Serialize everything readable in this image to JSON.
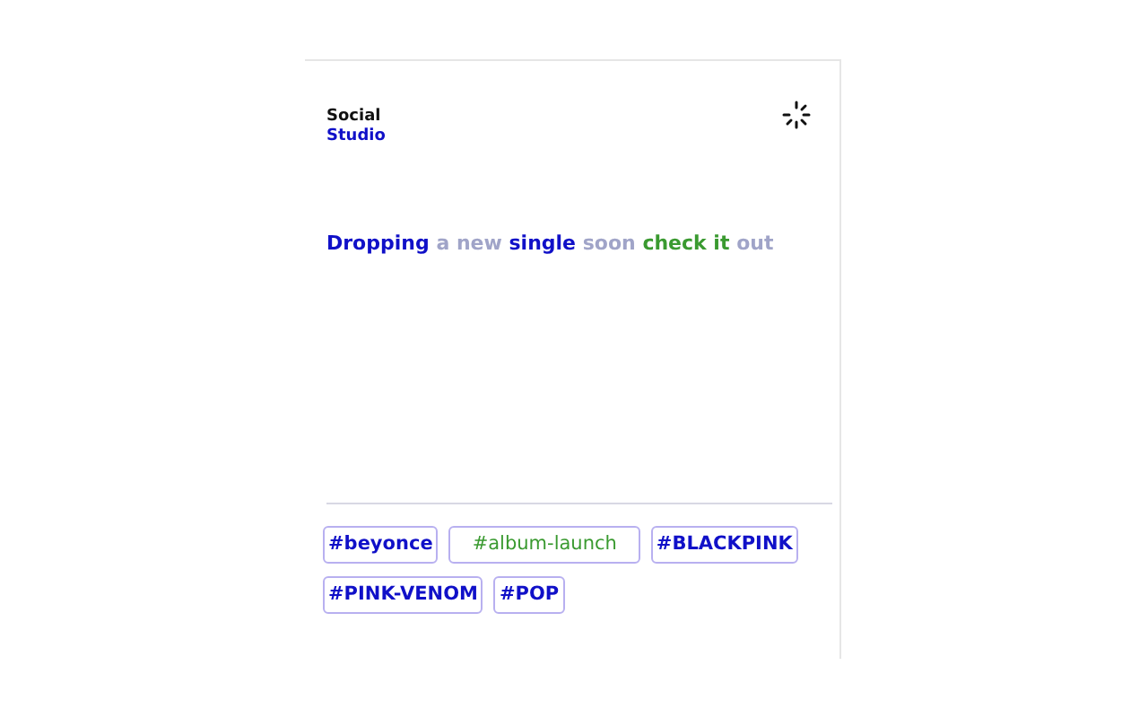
{
  "brand": {
    "line_1": "Social",
    "line_2": "Studio"
  },
  "post": {
    "segments": [
      {
        "text": "Dropping",
        "color": "#1010c8"
      },
      {
        "text": "a new",
        "color": "#a0a4c8"
      },
      {
        "text": "single",
        "color": "#1010c8"
      },
      {
        "text": "soon",
        "color": "#a0a4c8"
      },
      {
        "text": "check it",
        "color": "#3a9a30"
      },
      {
        "text": "out",
        "color": "#a0a4c8"
      }
    ]
  },
  "tags": [
    {
      "label": "#beyonce",
      "selected": false
    },
    {
      "label": "#album-launch",
      "selected": true
    },
    {
      "label": "#BLACKPINK",
      "selected": false
    },
    {
      "label": "#PINK-VENOM",
      "selected": false
    },
    {
      "label": "#POP",
      "selected": false
    }
  ]
}
